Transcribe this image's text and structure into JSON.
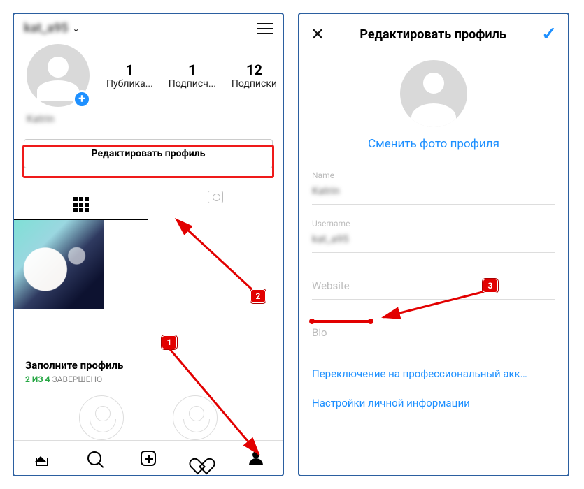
{
  "left": {
    "username_blur": "kat_a95",
    "stats": {
      "posts": {
        "count": "1",
        "label": "Публика..."
      },
      "followers": {
        "count": "1",
        "label": "Подписч..."
      },
      "following": {
        "count": "12",
        "label": "Подписки"
      }
    },
    "bio_name_blur": "Katrin",
    "edit_profile_label": "Редактировать профиль",
    "fill_profile": {
      "title": "Заполните профиль",
      "progress_done": "2 ИЗ 4",
      "progress_tail": " ЗАВЕРШЕНО"
    }
  },
  "right": {
    "title": "Редактировать профиль",
    "change_photo": "Сменить фото профиля",
    "fields": {
      "name": {
        "label": "Name",
        "value_blur": "Katrin"
      },
      "username": {
        "label": "Username",
        "value_blur": "kat_a95"
      },
      "website": {
        "placeholder": "Website"
      },
      "bio": {
        "placeholder": "Bio"
      }
    },
    "switch_pro": "Переключение на профессиональный акк…",
    "personal_info": "Настройки личной информации"
  },
  "annotations": {
    "b1": "1",
    "b2": "2",
    "b3": "3"
  }
}
